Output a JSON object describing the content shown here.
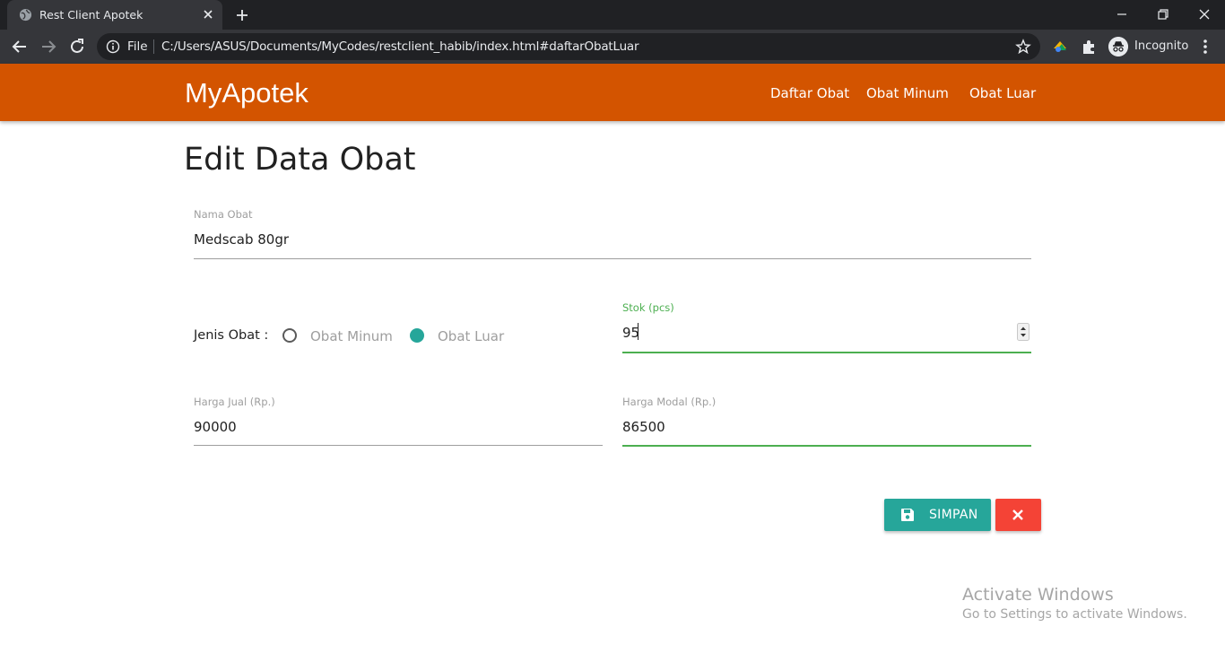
{
  "browser": {
    "tab_title": "Rest Client Apotek",
    "file_label": "File",
    "url": "C:/Users/ASUS/Documents/MyCodes/restclient_habib/index.html#daftarObatLuar",
    "profile_label": "Incognito",
    "tab_bg_color": "#35363a",
    "frame_color": "#202124"
  },
  "navbar": {
    "brand": "MyApotek",
    "links": [
      "Daftar Obat",
      "Obat Minum",
      "Obat Luar"
    ],
    "bg_color": "#d35400"
  },
  "page": {
    "title": "Edit Data Obat"
  },
  "form": {
    "nama_obat": {
      "label": "Nama Obat",
      "value": "Medscab 80gr"
    },
    "jenis_obat": {
      "label": "Jenis Obat :",
      "options": [
        "Obat Minum",
        "Obat Luar"
      ],
      "selected": "Obat Luar"
    },
    "stok": {
      "label": "Stok (pcs)",
      "value": "95"
    },
    "harga_jual": {
      "label": "Harga Jual (Rp.)",
      "value": "90000"
    },
    "harga_modal": {
      "label": "Harga Modal (Rp.)",
      "value": "86500"
    },
    "active_color": "#4caf50",
    "radio_color": "#26a69a"
  },
  "actions": {
    "save_label": "SIMPAN",
    "save_color": "#26a69a",
    "cancel_color": "#f44336"
  },
  "watermark": {
    "title": "Activate Windows",
    "subtitle": "Go to Settings to activate Windows."
  }
}
